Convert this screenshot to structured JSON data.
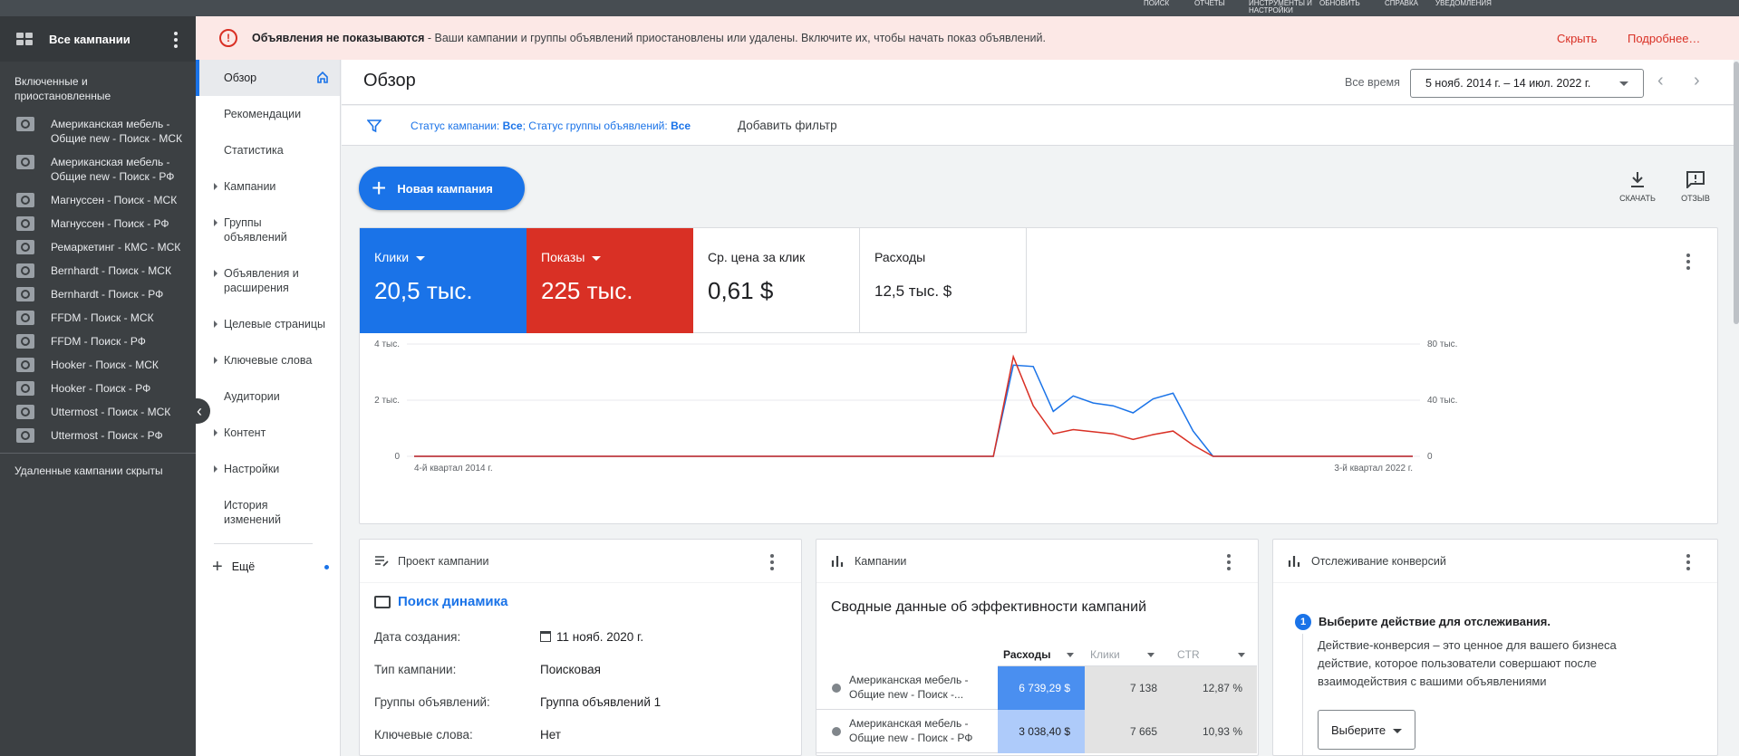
{
  "topbar": {
    "items": [
      "ПОИСК",
      "ОТЧЕТЫ",
      "ИНСТРУМЕНТЫ И НАСТРОЙКИ",
      "ОБНОВИТЬ",
      "СПРАВКА",
      "УВЕДОМЛЕНИЯ"
    ]
  },
  "campaigns": {
    "title": "Все кампании",
    "filter_label": "Включенные и приостановленные",
    "items": [
      {
        "label": "Американская мебель - Общие new - Поиск - МСК",
        "icon": "search-campaign-icon"
      },
      {
        "label": "Американская мебель - Общие new - Поиск - РФ",
        "icon": "search-campaign-icon"
      },
      {
        "label": "Магнуссен - Поиск - МСК",
        "icon": "search-campaign-icon"
      },
      {
        "label": "Магнуссен - Поиск - РФ",
        "icon": "search-campaign-icon"
      },
      {
        "label": "Ремаркетинг - КМС - МСК",
        "icon": "display-campaign-icon"
      },
      {
        "label": "Bernhardt - Поиск - МСК",
        "icon": "search-campaign-icon"
      },
      {
        "label": "Bernhardt - Поиск - РФ",
        "icon": "search-campaign-icon"
      },
      {
        "label": "FFDM - Поиск - МСК",
        "icon": "search-campaign-icon"
      },
      {
        "label": "FFDM - Поиск - РФ",
        "icon": "search-campaign-icon"
      },
      {
        "label": "Hooker - Поиск - МСК",
        "icon": "search-campaign-icon"
      },
      {
        "label": "Hooker - Поиск - РФ",
        "icon": "search-campaign-icon"
      },
      {
        "label": "Uttermost - Поиск - МСК",
        "icon": "search-campaign-icon"
      },
      {
        "label": "Uttermost - Поиск - РФ",
        "icon": "search-campaign-icon"
      }
    ],
    "deleted_label": "Удаленные кампании скрыты"
  },
  "nav": {
    "items": [
      {
        "label": "Обзор",
        "active": true
      },
      {
        "label": "Рекомендации"
      },
      {
        "label": "Статистика"
      },
      {
        "label": "Кампании",
        "expandable": true
      },
      {
        "label": "Группы объявлений",
        "expandable": true
      },
      {
        "label": "Объявления и расширения",
        "expandable": true
      },
      {
        "label": "Целевые страницы",
        "expandable": true
      },
      {
        "label": "Ключевые слова",
        "expandable": true
      },
      {
        "label": "Аудитории"
      },
      {
        "label": "Контент",
        "expandable": true
      },
      {
        "label": "Настройки",
        "expandable": true
      },
      {
        "label": "История изменений"
      }
    ],
    "more_label": "Ещё"
  },
  "alert": {
    "title": "Объявления не показываются",
    "text": " - Ваши кампании и группы объявлений приостановлены или удалены. Включите их, чтобы начать показ объявлений.",
    "hide": "Скрыть",
    "details": "Подробнее…"
  },
  "header": {
    "title": "Обзор",
    "range_label": "Все время",
    "date_range": "5 нояб. 2014 г. – 14 июл. 2022 г."
  },
  "filters": {
    "k1": "Статус кампании:",
    "v1": "Все",
    "k2": "; Статус группы объявлений:",
    "v2": "Все",
    "add": "Добавить фильтр"
  },
  "toolbar": {
    "new_campaign": "Новая кампания",
    "download": "СКАЧАТЬ",
    "feedback": "ОТЗЫВ"
  },
  "metrics": [
    {
      "label": "Клики",
      "value": "20,5 тыс."
    },
    {
      "label": "Показы",
      "value": "225 тыс."
    },
    {
      "label": "Ср. цена за клик",
      "value": "0,61 $"
    },
    {
      "label": "Расходы",
      "value": "12,5 тыс. $"
    }
  ],
  "chart_data": {
    "type": "line",
    "x_start_label": "4-й квартал 2014 г.",
    "x_end_label": "3-й квартал 2022 г.",
    "left_ticks": [
      "0",
      "2 тыс.",
      "4 тыс."
    ],
    "right_ticks": [
      "0",
      "40 тыс.",
      "80 тыс."
    ],
    "ylim_left": [
      0,
      4000
    ],
    "ylim_right": [
      0,
      80000
    ],
    "grid": true,
    "series": [
      {
        "name": "Клики",
        "color": "#1a73e8",
        "axis": "left",
        "values": [
          0,
          0,
          0,
          0,
          0,
          0,
          0,
          0,
          0,
          0,
          0,
          0,
          0,
          0,
          0,
          0,
          0,
          0,
          0,
          0,
          0,
          0,
          0,
          0,
          0,
          0,
          0,
          0,
          0,
          0,
          3250,
          3200,
          1600,
          2150,
          1900,
          1800,
          1550,
          2050,
          2250,
          900,
          0,
          0,
          0,
          0,
          0,
          0,
          0,
          0,
          0,
          0,
          0
        ]
      },
      {
        "name": "Показы",
        "color": "#d93025",
        "axis": "right",
        "values": [
          0,
          0,
          0,
          0,
          0,
          0,
          0,
          0,
          0,
          0,
          0,
          0,
          0,
          0,
          0,
          0,
          0,
          0,
          0,
          0,
          0,
          0,
          0,
          0,
          0,
          0,
          0,
          0,
          0,
          0,
          71000,
          36000,
          16000,
          19000,
          17500,
          16000,
          12000,
          15500,
          18000,
          8000,
          0,
          0,
          0,
          0,
          0,
          0,
          0,
          0,
          0,
          0,
          0
        ]
      }
    ]
  },
  "project": {
    "header": "Проект кампании",
    "name": "Поиск динамика",
    "rows": [
      {
        "label": "Дата создания:",
        "value": "11 нояб. 2020 г."
      },
      {
        "label": "Тип кампании:",
        "value": "Поисковая"
      },
      {
        "label": "Группы объявлений:",
        "value": "Группа объявлений 1"
      },
      {
        "label": "Ключевые слова:",
        "value": "Нет"
      }
    ]
  },
  "camps_card": {
    "header": "Кампании",
    "subtitle": "Сводные данные об эффективности кампаний",
    "columns": [
      "Расходы",
      "Клики",
      "CTR"
    ],
    "rows": [
      {
        "name": "Американская мебель - Общие new - Поиск -...",
        "cost": "6 739,29 $",
        "clicks": "7 138",
        "ctr": "12,87 %"
      },
      {
        "name": "Американская мебель - Общие new - Поиск - РФ",
        "cost": "3 038,40 $",
        "clicks": "7 665",
        "ctr": "10,93 %"
      }
    ]
  },
  "conversion": {
    "header": "Отслеживание конверсий",
    "step": "1",
    "title": "Выберите действие для отслеживания.",
    "desc": "Действие-конверсия – это ценное для вашего бизнеса действие, которое пользователи совершают после взаимодействия с вашими объявлениями",
    "select": "Выберите"
  }
}
